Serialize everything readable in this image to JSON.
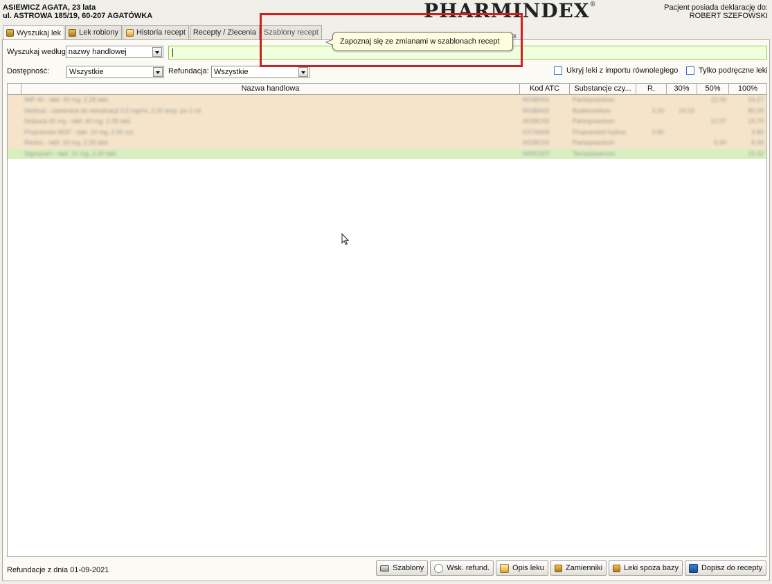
{
  "patient": {
    "name_line": "ASIEWICZ AGATA,  23 lata",
    "address_line": "ul. ASTROWA 185/19, 60-207 AGATÓWKA"
  },
  "logo": {
    "text": "PHARMINDEX",
    "mark": "®"
  },
  "declaration": {
    "label": "Pacjent posiada deklarację do:",
    "doctor": "ROBERT SZEFOWSKI"
  },
  "tabs": [
    {
      "label": "Wyszukaj lek",
      "icon": "drug-icon",
      "active": true
    },
    {
      "label": "Lek robiony",
      "icon": "drug-icon"
    },
    {
      "label": "Historia recept",
      "icon": "history-icon"
    },
    {
      "label": "Recepty / Zlecenia"
    },
    {
      "label": "Szablony recept"
    }
  ],
  "search": {
    "by_label": "Wyszukaj według",
    "by_value": "nazwy handlowej",
    "query": "",
    "availability_label": "Dostępność:",
    "availability_value": "Wszystkie",
    "refund_label": "Refundacja:",
    "refund_value": "Wszystkie",
    "hide_parallel_label": "Ukryj leki z importu równoległego",
    "only_handheld_label": "Tylko podręczne leki"
  },
  "grid": {
    "columns": [
      "",
      "Nazwa handlowa",
      "Kod ATC",
      "Substancje czy...",
      "R.",
      "30%",
      "50%",
      "100%"
    ],
    "rows": [
      {
        "name": "IMP 40 - tabl. 40 mg, 2.28 tabl.",
        "atc": "N03BX02",
        "subst": "Pantoprazolum",
        "r": "",
        "p30": "",
        "p50": "12.00",
        "p100": "19.27",
        "color": "orange"
      },
      {
        "name": "Nebbud - zawiesina do nebulizacji 0,5 mg/ml, 2.20 amp. po 2 ml",
        "atc": "R03BA02",
        "subst": "Budesonidum",
        "r": "3.20",
        "p30": "24.03",
        "p50": "",
        "p100": "80.09",
        "color": "orange"
      },
      {
        "name": "Nolpaza 40 mg - tabl. 40 mg, 2.28 tabl.",
        "atc": "A02BC02",
        "subst": "Pantoprazolum",
        "r": "",
        "p30": "",
        "p50": "12.07",
        "p100": "19.70",
        "color": "orange"
      },
      {
        "name": "Propranolol WZF - tabl. 10 mg, 2.50 szt.",
        "atc": "C07AA05",
        "subst": "Propranololi hydroc",
        "r": "3.80",
        "p30": "",
        "p50": "",
        "p100": "3.80",
        "color": "orange"
      },
      {
        "name": "Ranloc - tabl. 20 mg, 2.28 tabl.",
        "atc": "A02BC02",
        "subst": "Pantoprazolum",
        "r": "",
        "p30": "",
        "p50": "5.90",
        "p100": "8.49",
        "color": "orange"
      },
      {
        "name": "Signopam - tabl. 10 mg, 2.20 tabl.",
        "atc": "N05CD07",
        "subst": "Temazepamum",
        "r": "",
        "p30": "",
        "p50": "",
        "p100": "15.32",
        "color": "green"
      }
    ]
  },
  "tooltip": {
    "text": "Zapoznaj się ze zmianami w szablonach recept",
    "close": "x"
  },
  "footer": {
    "refund_date": "Refundacje z dnia 01-09-2021",
    "buttons": [
      {
        "label": "Szablony",
        "icon": "template-icon"
      },
      {
        "label": "Wsk. refund.",
        "icon": "refund-indicator-icon"
      },
      {
        "label": "Opis leku",
        "icon": "description-icon"
      },
      {
        "label": "Zamienniki",
        "icon": "drug-icon"
      },
      {
        "label": "Leki spoza bazy",
        "icon": "drug-icon"
      },
      {
        "label": "Dopisz do recepty",
        "icon": "add-to-prescription-icon"
      }
    ]
  },
  "colors": {
    "row_orange": "#f5e4c9",
    "row_green": "#d9efc0",
    "highlight": "#cc1f1f",
    "search_bg": "#f2ffdf"
  }
}
